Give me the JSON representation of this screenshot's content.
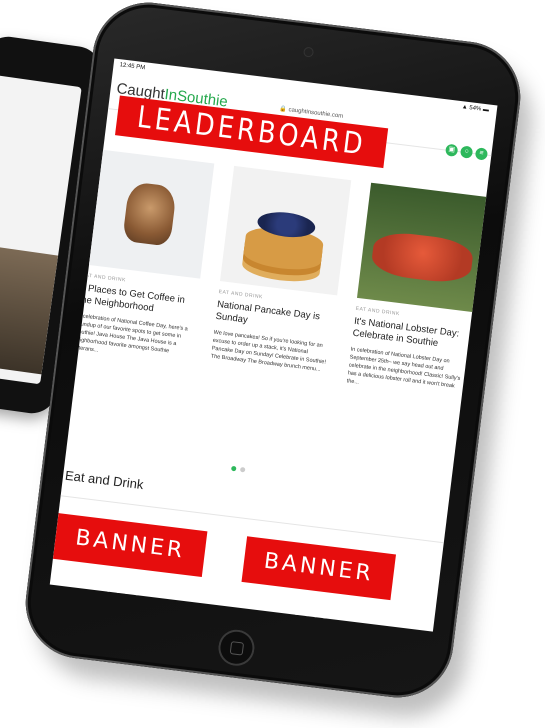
{
  "status": {
    "time": "12:45 PM",
    "battery": "54%"
  },
  "site": {
    "logo_part1": "Caught",
    "logo_part2": "InSouthie",
    "url": "caughtinsouthie.com"
  },
  "ads": {
    "leaderboard": "LEADERBOARD AD",
    "banner1": "BANNER AD",
    "banner2": "BANNER AD"
  },
  "articles": [
    {
      "category": "EAT AND DRINK",
      "title": "7 Places to Get Coffee in the Neighborhood",
      "excerpt": "In celebration of National Coffee Day, here's a roundup of our favorite spots to get some in Southie! Java House The Java House is a neighborhood favorite amongst Southie veterans..."
    },
    {
      "category": "EAT AND DRINK",
      "title": "National Pancake Day is Sunday",
      "excerpt": "We love pancakes! So if you're looking for an excuse to order up a stack, it's National Pancake Day on Sunday! Celebrate in Southie! The Broadway The Broadway brunch menu..."
    },
    {
      "category": "EAT AND DRINK",
      "title": "It's National Lobster Day: Celebrate in Southie",
      "excerpt": "In celebration of National Lobster Day on September 25th– we say head out and celebrate in the neighborhood! Classic! Sully's has a delicious lobster roll and it won't break the..."
    }
  ],
  "section": {
    "title": "Eat and Drink"
  },
  "colors": {
    "brand": "#24a84c",
    "ad": "#e60d0d"
  },
  "icons": [
    "gift-icon",
    "search-icon",
    "menu-icon"
  ]
}
